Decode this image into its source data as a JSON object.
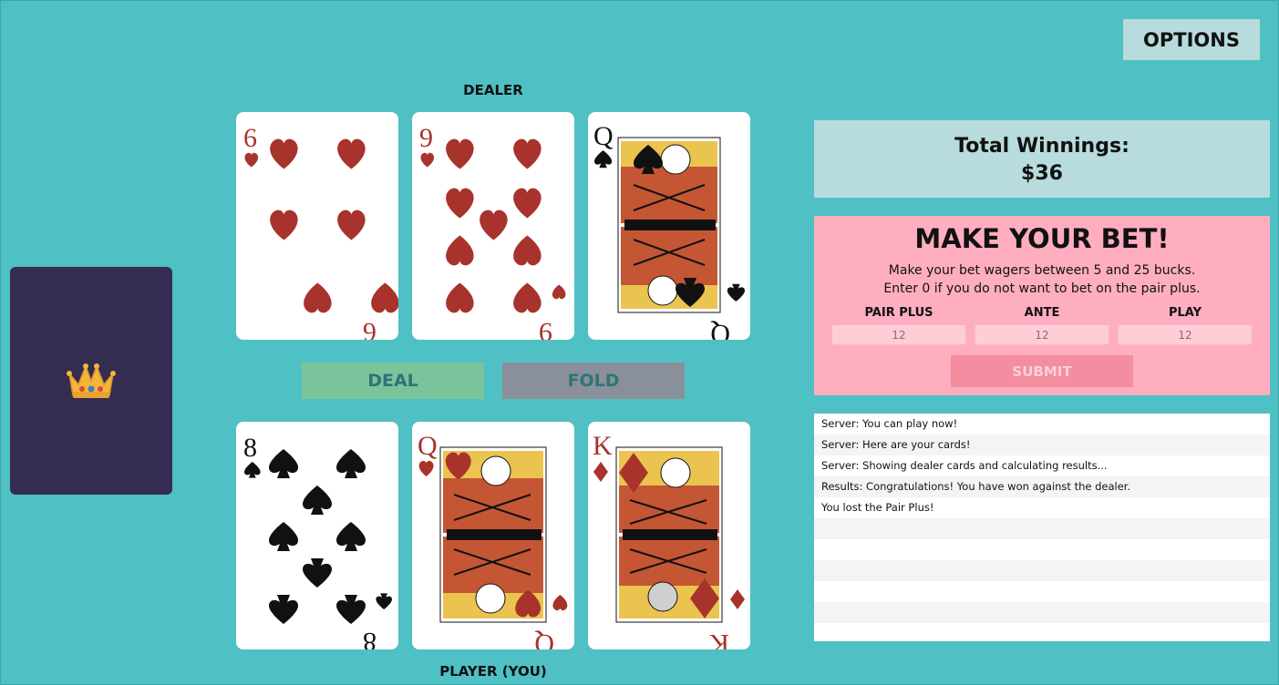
{
  "options_label": "OPTIONS",
  "dealer_label": "DEALER",
  "player_label": "PLAYER (YOU)",
  "deal_label": "DEAL",
  "fold_label": "FOLD",
  "winnings": {
    "title": "Total Winnings:",
    "amount": "$36"
  },
  "bet": {
    "title": "MAKE YOUR BET!",
    "line1": "Make your bet wagers between 5 and 25 bucks.",
    "line2": "Enter 0 if you do not want to bet on the pair plus.",
    "pair_plus_label": "PAIR PLUS",
    "ante_label": "ANTE",
    "play_label": "PLAY",
    "pair_plus_placeholder": "12",
    "ante_placeholder": "12",
    "play_placeholder": "12",
    "submit_label": "SUBMIT"
  },
  "log": [
    "Server: You can play now!",
    "Server: Here are your cards!",
    "Server: Showing dealer cards and calculating results...",
    "Results: Congratulations! You have won against the dealer.",
    "You lost the Pair Plus!",
    "",
    "",
    "",
    "",
    "",
    ""
  ],
  "cards": {
    "dealer": [
      {
        "rank": "6",
        "suit": "hearts"
      },
      {
        "rank": "9",
        "suit": "hearts"
      },
      {
        "rank": "Q",
        "suit": "spades"
      }
    ],
    "player": [
      {
        "rank": "8",
        "suit": "spades"
      },
      {
        "rank": "Q",
        "suit": "hearts"
      },
      {
        "rank": "K",
        "suit": "diamonds"
      }
    ]
  },
  "colors": {
    "table": "#4fc0c4",
    "deck_back": "#352c52",
    "red_suit": "#a8332c",
    "bet_panel": "#ffaec0"
  },
  "icons": {
    "deck_emblem": "crown-icon"
  }
}
